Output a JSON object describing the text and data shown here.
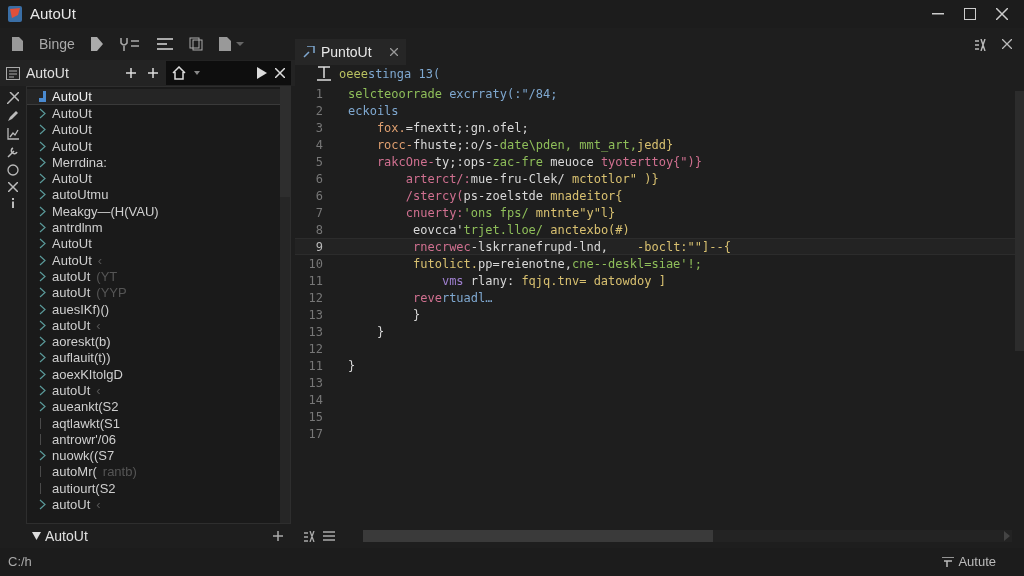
{
  "window": {
    "title": "AutoUt"
  },
  "toolbar": {
    "label": "Binge"
  },
  "sidebar": {
    "title": "AutoUt",
    "items": [
      {
        "label": "AutoUt",
        "selected": true,
        "expandable": true
      },
      {
        "label": "AutoUt",
        "selected": false,
        "expandable": true
      },
      {
        "label": "AutoUt",
        "selected": false,
        "expandable": true
      },
      {
        "label": "AutoUt",
        "selected": false,
        "expandable": true
      },
      {
        "label": "Merrdina:",
        "selected": false,
        "expandable": true
      },
      {
        "label": "AutoUt",
        "selected": false,
        "expandable": true
      },
      {
        "label": "autoUtmu",
        "selected": false,
        "expandable": true
      },
      {
        "label": "Meakgy—(H(VAU)",
        "selected": false,
        "expandable": true
      },
      {
        "label": "antrdlnm",
        "selected": false,
        "expandable": true
      },
      {
        "label": "AutoUt",
        "selected": false,
        "expandable": true
      },
      {
        "label": "AutoUt",
        "suffix": "‹",
        "selected": false,
        "expandable": true
      },
      {
        "label": "autoUt",
        "suffix": "(YT",
        "selected": false,
        "expandable": true
      },
      {
        "label": "autoUt",
        "suffix": "(YYP",
        "selected": false,
        "expandable": true
      },
      {
        "label": "auesIKf)()",
        "selected": false,
        "expandable": true
      },
      {
        "label": "autoUt",
        "suffix": "‹",
        "selected": false,
        "expandable": true
      },
      {
        "label": "aoreskt(b)",
        "selected": false,
        "expandable": true
      },
      {
        "label": "auflauit(t))",
        "selected": false,
        "expandable": true
      },
      {
        "label": "aoexKItolgD",
        "selected": false,
        "expandable": true
      },
      {
        "label": "autoUt",
        "suffix": "‹",
        "selected": false,
        "expandable": true
      },
      {
        "label": "aueankt(S2",
        "selected": false,
        "expandable": true
      },
      {
        "label": "aqtlawkt(S1",
        "selected": false,
        "expandable": false
      },
      {
        "label": "antrowr'/06",
        "selected": false,
        "expandable": false
      },
      {
        "label": "nuowk((S7",
        "selected": false,
        "expandable": true
      },
      {
        "label": "autoMr(",
        "suffix": "rantb)",
        "selected": false,
        "expandable": false
      },
      {
        "label": "autiourt(S2",
        "selected": false,
        "expandable": false
      },
      {
        "label": "autoUt",
        "suffix": "‹",
        "selected": false,
        "expandable": true
      }
    ],
    "section": {
      "title": "AutoUt",
      "expanded": true
    }
  },
  "editor": {
    "tab": {
      "label": "PuntoUt",
      "selected": true
    },
    "header": [
      {
        "text": "oeee",
        "color": "#b8c060"
      },
      {
        "text": "stinga 13(",
        "color": "#7fa8d0"
      }
    ],
    "lines": [
      {
        "number": "1",
        "current": false,
        "tokens": [
          {
            "text": "selcteoorrade",
            "color": "#8fbf5a"
          },
          {
            "text": " excrraty(:\"/84;",
            "color": "#7fa8d0"
          }
        ]
      },
      {
        "number": "2",
        "current": false,
        "tokens": [
          {
            "text": "eckoils",
            "color": "#7fa8d0"
          }
        ]
      },
      {
        "number": "3",
        "current": false,
        "tokens": [
          {
            "text": "    fox.",
            "color": "#e0a070"
          },
          {
            "text": "=fnextt;:gn.ofel;",
            "color": "#d8d8d8"
          }
        ]
      },
      {
        "number": "4",
        "current": false,
        "tokens": [
          {
            "text": "    rocc-",
            "color": "#e0a070"
          },
          {
            "text": "fhuste;:o/s-",
            "color": "#d8d8d8"
          },
          {
            "text": "date\\pden, mmt_art,",
            "color": "#8fbf5a"
          },
          {
            "text": "jedd}",
            "color": "#d8c070"
          }
        ]
      },
      {
        "number": "5",
        "current": false,
        "tokens": [
          {
            "text": "    rakcOne-",
            "color": "#d07090"
          },
          {
            "text": "ty;:ops-",
            "color": "#d8d8d8"
          },
          {
            "text": "zac-fre",
            "color": "#8fbf5a"
          },
          {
            "text": " meuoce ",
            "color": "#d8d8d8"
          },
          {
            "text": "tyoterttoy{\")}",
            "color": "#d07090"
          }
        ]
      },
      {
        "number": "6",
        "current": false,
        "tokens": [
          {
            "text": "        arterct/:",
            "color": "#d07090"
          },
          {
            "text": "mue-fru-Clek/",
            "color": "#d8d8d8"
          },
          {
            "text": " mctotlor\" )}",
            "color": "#d8c070"
          }
        ]
      },
      {
        "number": "6",
        "current": false,
        "tokens": [
          {
            "text": "        /stercy(",
            "color": "#d07090"
          },
          {
            "text": "ps-zoelstde",
            "color": "#d8d8d8"
          },
          {
            "text": " mnadeitor{",
            "color": "#d8c070"
          }
        ]
      },
      {
        "number": "7",
        "current": false,
        "tokens": [
          {
            "text": "        cnuerty:",
            "color": "#d07090"
          },
          {
            "text": "'ons fps/",
            "color": "#8fbf5a"
          },
          {
            "text": " mntnte\"y\"l}",
            "color": "#d8c070"
          }
        ]
      },
      {
        "number": "8",
        "current": false,
        "tokens": [
          {
            "text": "         eovcca'",
            "color": "#d8d8d8"
          },
          {
            "text": "trjet.lloe/",
            "color": "#8fbf5a"
          },
          {
            "text": " anctexbo(#)",
            "color": "#d8c070"
          }
        ]
      },
      {
        "number": "9",
        "current": true,
        "tokens": [
          {
            "text": "         rnecrwec",
            "color": "#d07090"
          },
          {
            "text": "-lskrranefrupd-lnd,",
            "color": "#d8d8d8"
          },
          {
            "text": "    -boclt:\"\"]--{",
            "color": "#d8c070"
          }
        ]
      },
      {
        "number": "10",
        "current": false,
        "tokens": [
          {
            "text": "         futolict.",
            "color": "#d8c070"
          },
          {
            "text": "pp=reienotne,",
            "color": "#d8d8d8"
          },
          {
            "text": "cne--deskl=siae'!;",
            "color": "#8fbf5a"
          }
        ]
      },
      {
        "number": "11",
        "current": false,
        "tokens": [
          {
            "text": "             vms",
            "color": "#a080d0"
          },
          {
            "text": " rlany:",
            "color": "#d8d8d8"
          },
          {
            "text": " fqjq.tnv= datowdoy ]",
            "color": "#d8c070"
          }
        ]
      },
      {
        "number": "12",
        "current": false,
        "tokens": [
          {
            "text": "         reve",
            "color": "#d07090"
          },
          {
            "text": "rtuadl…",
            "color": "#7fa8d0"
          }
        ]
      },
      {
        "number": "13",
        "current": false,
        "tokens": [
          {
            "text": "         }",
            "color": "#d8d8d8"
          }
        ]
      },
      {
        "number": "13",
        "current": false,
        "tokens": [
          {
            "text": "    }",
            "color": "#d8d8d8"
          }
        ]
      },
      {
        "number": "12",
        "current": false
      },
      {
        "number": "11",
        "current": false,
        "tokens": [
          {
            "text": "}",
            "color": "#d8d8d8"
          }
        ]
      },
      {
        "number": "13",
        "current": false
      },
      {
        "number": "14",
        "current": false
      },
      {
        "number": "15",
        "current": false
      },
      {
        "number": "17",
        "current": false
      }
    ]
  },
  "status_bar": {
    "left": "C:/h",
    "right": "Autute"
  }
}
